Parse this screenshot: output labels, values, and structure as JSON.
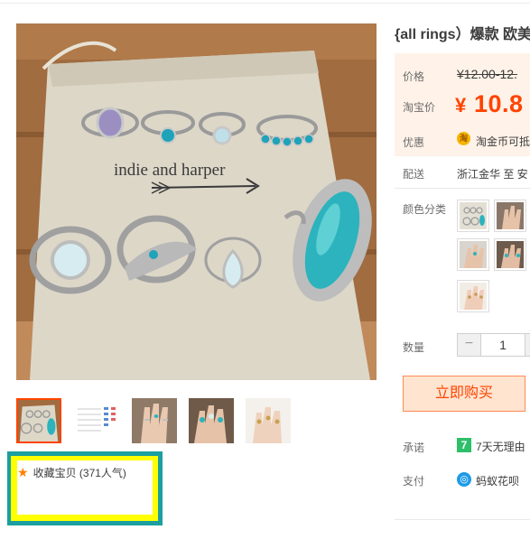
{
  "product": {
    "title": "{all rings）爆款 欧美",
    "photo_caption": "indie and harper"
  },
  "thumbnails": [
    {
      "name": "rings-on-bag"
    },
    {
      "name": "size-chart"
    },
    {
      "name": "hand-rings-1"
    },
    {
      "name": "hand-rings-2"
    },
    {
      "name": "hand-rings-3"
    }
  ],
  "favorite": {
    "icon": "star-icon",
    "label": "收藏宝贝 (371人气)",
    "star_color": "#ff7f00"
  },
  "price": {
    "label": "价格",
    "original": "¥12.00-12.",
    "taobao_label": "淘宝价",
    "currency_symbol": "¥",
    "current": "10.8",
    "accent_color": "#ff4400"
  },
  "promo": {
    "label": "优惠",
    "coin_icon": "淘",
    "text": "淘金币可抵"
  },
  "shipping": {
    "label": "配送",
    "text": "浙江金华 至  安"
  },
  "color_options": {
    "label": "颜色分类",
    "items": [
      "option-1",
      "option-2",
      "option-3",
      "option-4",
      "option-5"
    ]
  },
  "quantity": {
    "label": "数量",
    "minus": "−",
    "value": "1"
  },
  "buy": {
    "label": "立即购买"
  },
  "promise": {
    "label": "承诺",
    "icon": "7",
    "text": "7天无理由"
  },
  "payment": {
    "label": "支付",
    "text": "蚂蚁花呗"
  }
}
